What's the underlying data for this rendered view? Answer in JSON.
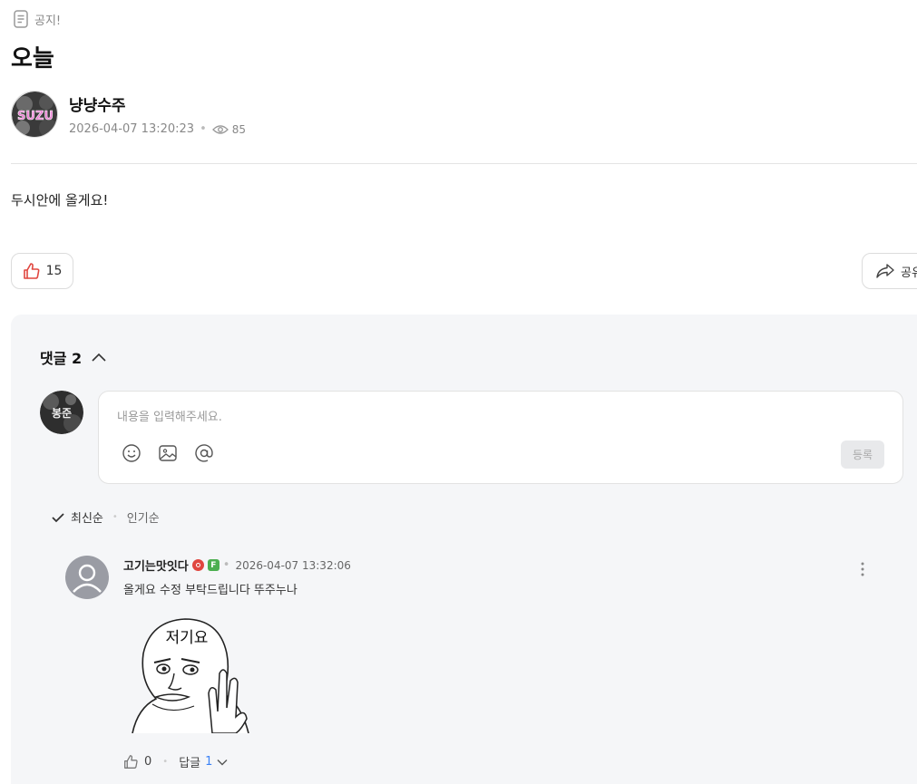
{
  "post": {
    "notice_label": "공지!",
    "title": "오늘",
    "author_name": "냥냥수주",
    "author_avatar_text": "SUZU",
    "date": "2026-04-07 13:20:23",
    "views": "85",
    "body": "두시안에 올게요!",
    "likes": "15",
    "share_label": "공유"
  },
  "comments": {
    "label": "댓글",
    "count": "2",
    "input_placeholder": "내용을 입력해주세요.",
    "submit_label": "등록",
    "my_avatar_text": "봉준",
    "sort_active": "최신순",
    "sort_other": "인기순",
    "items": [
      {
        "author": "고기는맛잇다",
        "badge_green": "F",
        "date": "2026-04-07 13:32:06",
        "text": "올게요 수정 부탁드립니다 뚜주누나",
        "sticker_text": "저기요",
        "likes": "0",
        "reply_label": "답글",
        "reply_count": "1"
      }
    ]
  },
  "colors": {
    "accent_like": "#e0463f",
    "reply_count": "#3b82f6",
    "panel_bg": "#f5f6f8"
  }
}
